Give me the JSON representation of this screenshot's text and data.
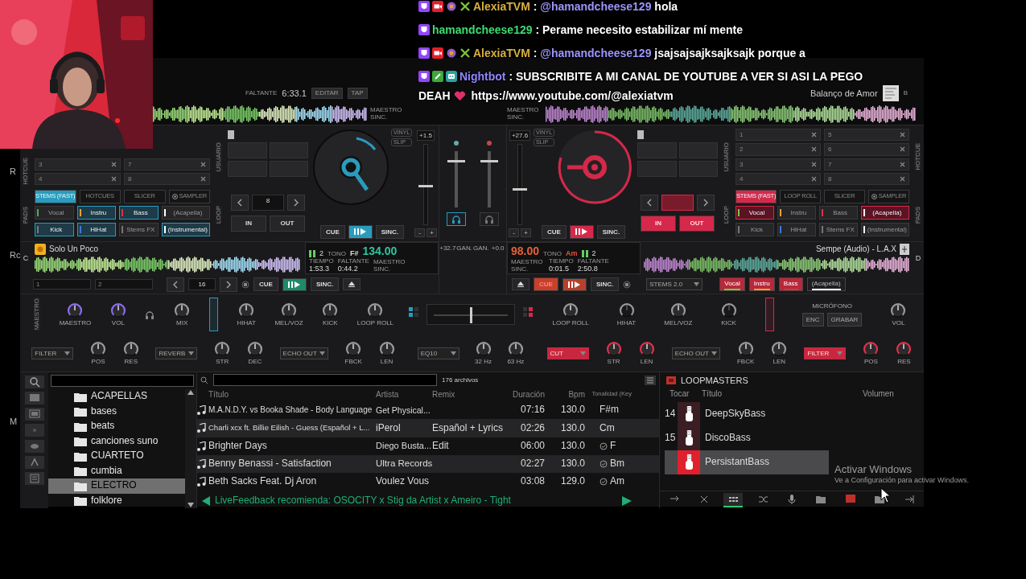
{
  "chat": [
    {
      "kind": "streamer",
      "user": "AlexiaTVM",
      "color": "#d8b040",
      "separator": ":",
      "mention": "@hamandcheese129",
      "message": "hola"
    },
    {
      "kind": "viewer",
      "user": "hamandcheese129",
      "color": "#3ddc6e",
      "separator": ":",
      "message": "Perame necesito estabilizar mí mente"
    },
    {
      "kind": "streamer",
      "user": "AlexiaTVM",
      "color": "#d8b040",
      "separator": ":",
      "mention": "@hamandcheese129",
      "message": "jsajsajsajksajksajk porque a"
    },
    {
      "kind": "bot",
      "user": "Nightbot",
      "color": "#8f86ff",
      "separator": ":",
      "message": "SUBSCRIBITE A MI CANAL DE YOUTUBE A VER SI ASI LA PEGO",
      "continuation": "DEAH",
      "heart": true,
      "link": "https://www.youtube.com/@alexiatvm"
    }
  ],
  "edge_labels": [
    "R",
    "Rc",
    "M"
  ],
  "overview": [
    {
      "remaining_label": "FALTANTE",
      "remaining": "6:33.1",
      "buttons": [
        "EDITAR",
        "TAP"
      ],
      "sync": "MAESTRO SINC."
    },
    {
      "sync": "MAESTRO SINC.",
      "title": "Balanço de Amor",
      "letter": "B"
    }
  ],
  "decks": [
    {
      "color": "#2a9bbd",
      "pitch": "+1.5",
      "level": 0.5,
      "pitch_buttons": [
        "-",
        "+"
      ],
      "vinyl": "VINYL",
      "slip": "SLIP",
      "labels": {
        "hotcue": "HOTCUE",
        "user": "USUARIO",
        "pads": "PADS",
        "loop": "LOOP"
      },
      "hotcues": [
        [
          "3",
          "4"
        ],
        [
          "7",
          "8"
        ]
      ],
      "tabs": [
        {
          "label": "STEMS (FAST)",
          "kind": "mode",
          "selected": true
        },
        {
          "label": "HOTCUES",
          "kind": "mode",
          "selected": false
        },
        {
          "label": "SLICER",
          "kind": "mode",
          "selected": false
        },
        {
          "label": "SAMPLER",
          "kind": "sampler",
          "selected": false
        }
      ],
      "pads": [
        {
          "label": "Vocal",
          "color": "#4caf50",
          "selected": false
        },
        {
          "label": "Instru",
          "color": "#f0a030",
          "selected": true
        },
        {
          "label": "Bass",
          "color": "#e0303a",
          "selected": true
        },
        {
          "label": "(Acapella)",
          "color": "#ffffff",
          "selected": false
        },
        {
          "label": "Kick",
          "color": "#777777",
          "selected": true
        },
        {
          "label": "HiHat",
          "color": "#3a7bd5",
          "selected": true
        },
        {
          "label": "Stems FX",
          "color": "#777777",
          "selected": false
        },
        {
          "label": "(Instrumental)",
          "color": "#ffffff",
          "selected": true
        }
      ],
      "loop": {
        "size": "8",
        "in": "IN",
        "out": "OUT",
        "active": false
      },
      "transport": {
        "cue": "CUE",
        "sync": "SINC."
      }
    },
    {
      "color": "#d6284a",
      "pitch": "+27.6",
      "level": 0.45,
      "pitch_buttons": [
        "-",
        "+"
      ],
      "vinyl": "VINYL",
      "slip": "SLIP",
      "labels": {
        "hotcue": "HOTCUE",
        "user": "USUARIO",
        "pads": "PADS",
        "loop": "LOOP"
      },
      "hotcues": [
        [
          "1",
          "2",
          "3",
          "4"
        ],
        [
          "5",
          "6",
          "7",
          "8"
        ]
      ],
      "tabs": [
        {
          "label": "STEMS (FAST)",
          "kind": "mode",
          "selected": true
        },
        {
          "label": "LOOP ROLL",
          "kind": "mode",
          "selected": false
        },
        {
          "label": "SLICER",
          "kind": "mode",
          "selected": false
        },
        {
          "label": "SAMPLER",
          "kind": "sampler",
          "selected": false
        }
      ],
      "pads": [
        {
          "label": "Vocal",
          "color": "#7ac943",
          "selected": true
        },
        {
          "label": "Instru",
          "color": "#f0a030",
          "selected": false
        },
        {
          "label": "Bass",
          "color": "#e0303a",
          "selected": false
        },
        {
          "label": "(Acapella)",
          "color": "#ffffff",
          "selected": true
        },
        {
          "label": "Kick",
          "color": "#777777",
          "selected": false
        },
        {
          "label": "HiHat",
          "color": "#3a7bd5",
          "selected": false
        },
        {
          "label": "Stems FX",
          "color": "#777777",
          "selected": false
        },
        {
          "label": "(Instrumental)",
          "color": "#ffffff",
          "selected": false
        }
      ],
      "loop": {
        "in": "IN",
        "out": "OUT",
        "active": true
      },
      "transport": {
        "cue": "CUE",
        "sync": "SINC."
      }
    }
  ],
  "mixer": {
    "headphones": [
      {
        "selected": true
      },
      {
        "selected": false
      }
    ],
    "faders": [
      {
        "level": 0.85
      },
      {
        "level": 0.85
      }
    ]
  },
  "info": [
    {
      "letter": "C",
      "title": "Solo Un Poco",
      "stems": "2",
      "key_label": "TONO",
      "key": "F#",
      "bpm": "134.00",
      "time_label": "TIEMPO",
      "time": "1:53.3",
      "remaining_label": "FALTANTE",
      "remaining": "0:44.2",
      "sync": "MAESTRO SINC.",
      "slots": [
        "1",
        "2"
      ],
      "jump": "16",
      "cue": "CUE",
      "sync_button": "SINC.",
      "cue_active": false
    },
    {
      "letter": "D",
      "title": "Sempe (Audio) - L.A.X",
      "stems": "2",
      "key_label": "TONO",
      "key": "Am",
      "bpm": "98.00",
      "time_label": "TIEMPO",
      "time": "0:01.5",
      "remaining_label": "FALTANTE",
      "remaining": "2:50.8",
      "sync": "MAESTRO SINC.",
      "cue": "CUE",
      "sync_button": "SINC.",
      "cue_active": true,
      "stems_mode": "STEMS 2.0",
      "stem_buttons": [
        {
          "label": "Vocal",
          "color": "#7ac943",
          "selected": true
        },
        {
          "label": "Instru",
          "color": "#f0a030",
          "selected": true
        },
        {
          "label": "Bass",
          "color": "#e0303a",
          "selected": true
        },
        {
          "label": "(Acapella)",
          "color": "#ffffff",
          "selected": false
        }
      ]
    }
  ],
  "gain_center": [
    "+32.7",
    "GAN.",
    "GAN.",
    "+0.0"
  ],
  "fx": {
    "master_label": "MAESTRO",
    "top_left": [
      {
        "kind": "knob",
        "label": "MAESTRO",
        "color": "#8a6cf0"
      },
      {
        "kind": "knob",
        "label": "VOL",
        "color": "#8a6cf0"
      },
      {
        "kind": "icon"
      },
      {
        "kind": "knob",
        "label": "MIX",
        "color": "#9a9a9a"
      },
      {
        "kind": "deckbar",
        "color": "#2a9bbd"
      },
      {
        "kind": "knob",
        "label": "HIHAT",
        "color": "#9a9a9a"
      },
      {
        "kind": "knob",
        "label": "MEL/VOZ",
        "color": "#9a9a9a"
      },
      {
        "kind": "knob",
        "label": "KICK",
        "color": "#9a9a9a"
      },
      {
        "kind": "knob",
        "label": "LOOP ROLL",
        "color": "#9a9a9a"
      }
    ],
    "crossfader": {
      "level": 0.5
    },
    "top_right": [
      {
        "kind": "knob",
        "label": "LOOP ROLL",
        "color": "#9a9a9a",
        "disabled": false
      },
      {
        "kind": "knob",
        "label": "HIHAT",
        "color": "#9a9a9a",
        "disabled": true
      },
      {
        "kind": "knob",
        "label": "MEL/VOZ",
        "color": "#9a9a9a",
        "disabled": false
      },
      {
        "kind": "knob",
        "label": "KICK",
        "color": "#9a9a9a",
        "disabled": true
      },
      {
        "kind": "deckbar",
        "color": "#d6284a",
        "disabled": false
      }
    ],
    "mic": {
      "label": "MICRÓFONO",
      "buttons": [
        "ENC",
        "GRABAR"
      ],
      "knob": {
        "label": "VOL",
        "color": "#9a9a9a"
      }
    },
    "bottom_left": [
      {
        "kind": "dropdown",
        "label": "FILTER",
        "active": false
      },
      {
        "kind": "knob",
        "label": "POS",
        "color": "#9a9a9a"
      },
      {
        "kind": "knob",
        "label": "RES",
        "color": "#9a9a9a"
      },
      {
        "kind": "dropdown",
        "label": "REVERB",
        "active": false
      },
      {
        "kind": "knob",
        "label": "STR",
        "color": "#9a9a9a"
      },
      {
        "kind": "knob",
        "label": "DEC",
        "color": "#9a9a9a"
      },
      {
        "kind": "dropdown",
        "label": "ECHO OUT",
        "active": false
      },
      {
        "kind": "knob",
        "label": "FBCK",
        "color": "#9a9a9a"
      },
      {
        "kind": "knob",
        "label": "LEN",
        "color": "#9a9a9a"
      }
    ],
    "bottom_center": [
      {
        "kind": "dropdown",
        "label": "EQ10",
        "active": false
      },
      {
        "kind": "knob",
        "label": "32 Hz",
        "color": "#9a9a9a"
      },
      {
        "kind": "knob",
        "label": "63 Hz",
        "color": "#9a9a9a"
      }
    ],
    "bottom_right": [
      {
        "kind": "dropdown",
        "label": "CUT",
        "active": true
      },
      {
        "kind": "knob",
        "label": "STR",
        "color": "#e0304a"
      },
      {
        "kind": "knob",
        "label": "LEN",
        "color": "#e0304a"
      },
      {
        "kind": "dropdown",
        "label": "ECHO OUT",
        "active": false
      },
      {
        "kind": "knob",
        "label": "FBCK",
        "color": "#9a9a9a"
      },
      {
        "kind": "knob",
        "label": "LEN",
        "color": "#9a9a9a"
      },
      {
        "kind": "dropdown",
        "label": "FILTER",
        "active": true
      },
      {
        "kind": "knob",
        "label": "POS",
        "color": "#e0304a"
      },
      {
        "kind": "knob",
        "label": "RES",
        "color": "#e0304a"
      }
    ]
  },
  "folders": [
    {
      "label": "ACAPELLAS",
      "selected": false
    },
    {
      "label": "bases",
      "selected": false
    },
    {
      "label": "beats",
      "selected": false
    },
    {
      "label": "canciones suno",
      "selected": false
    },
    {
      "label": "CUARTETO",
      "selected": false
    },
    {
      "label": "cumbia",
      "selected": false
    },
    {
      "label": "ELECTRO",
      "selected": true
    },
    {
      "label": "folklore",
      "selected": false
    }
  ],
  "files": {
    "count": "176 archivos",
    "columns": [
      "Título",
      "Artista",
      "Remix",
      "Duración",
      "Bpm",
      "Tonalidad (Key"
    ],
    "rows": [
      {
        "cells": [
          "M.A.N.D.Y. vs Booka Shade - Body Language",
          "Get Physical...",
          "",
          "07:16",
          "130.0",
          "F#m"
        ],
        "analyzed": false
      },
      {
        "cells": [
          "Charli xcx ft. Billie Eilish - Guess (Español + L...",
          "iPerol",
          "Español + Lyrics",
          "02:26",
          "130.0",
          "Cm"
        ],
        "analyzed": false
      },
      {
        "cells": [
          "Brighter Days",
          "Diego Busta...",
          "Edit",
          "06:00",
          "130.0",
          "F"
        ],
        "analyzed": true
      },
      {
        "cells": [
          "Benny Benassi - Satisfaction",
          "Ultra Records",
          "",
          "02:27",
          "130.0",
          "Bm"
        ],
        "analyzed": true
      },
      {
        "cells": [
          "Beth Sacks Feat. Dj Aron",
          "Voulez Vous",
          "",
          "03:08",
          "129.0",
          "Am"
        ],
        "analyzed": true
      }
    ],
    "feedback": "LiveFeedback recomienda: OSOCITY x Stig da Artist x Ameiro - Tight"
  },
  "loops": {
    "title": "LOOPMASTERS",
    "columns": [
      "Tocar",
      "Título",
      "Volumen"
    ],
    "items": [
      {
        "number": "14",
        "name": "DeepSkyBass",
        "selected": false
      },
      {
        "number": "15",
        "name": "DiscoBass",
        "selected": false
      },
      {
        "name": "PersistantBass",
        "selected": true
      }
    ],
    "toolbar": [
      {
        "selected": false
      },
      {
        "selected": false
      },
      {
        "selected": true
      },
      {
        "selected": false
      },
      {
        "selected": false
      },
      {
        "selected": false
      },
      {
        "selected": false
      },
      {
        "selected": false
      },
      {
        "selected": false
      }
    ]
  },
  "watermark": {
    "title": "Activar Windows",
    "subtitle": "Ve a Configuración para activar Windows."
  }
}
